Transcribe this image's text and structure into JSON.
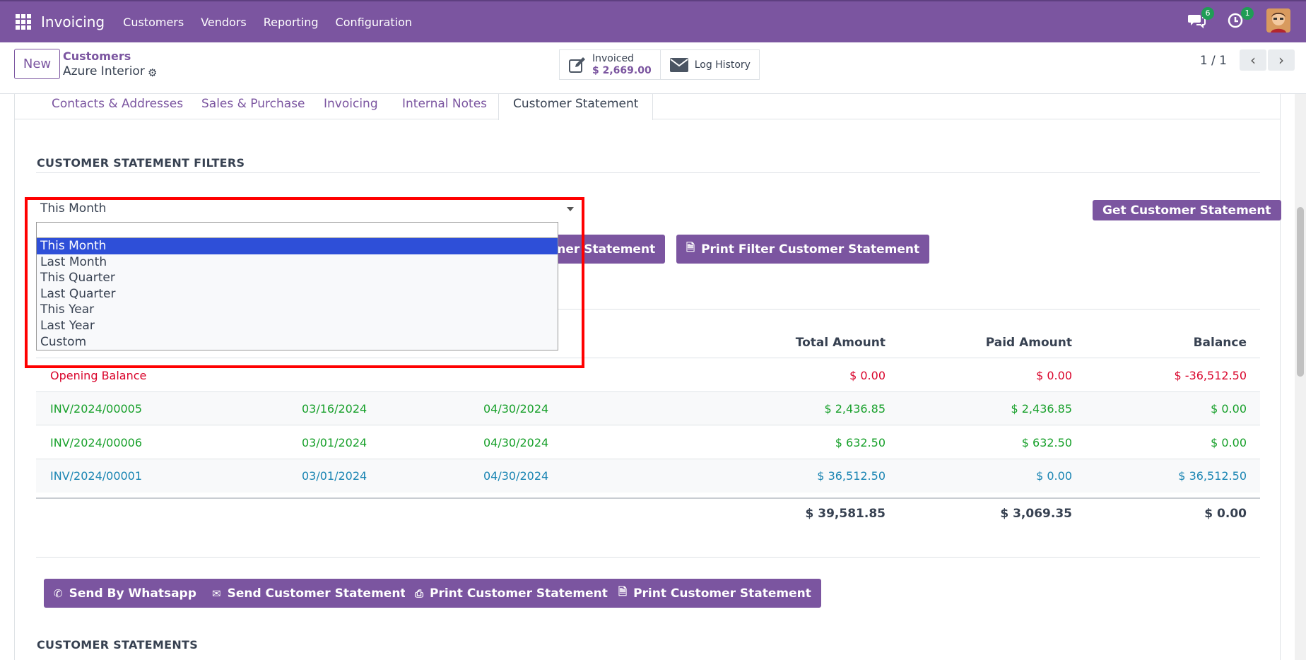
{
  "navbar": {
    "app_title": "Invoicing",
    "menu": [
      "Customers",
      "Vendors",
      "Reporting",
      "Configuration"
    ],
    "chat_badge": "6",
    "activity_badge": "1",
    "color": "#7b55a0"
  },
  "control": {
    "new_label": "New",
    "breadcrumb_parent": "Customers",
    "breadcrumb_current": "Azure Interior",
    "invoiced_label": "Invoiced",
    "invoiced_value": "$ 2,669.00",
    "log_history_label": "Log History",
    "pager": "1 / 1"
  },
  "tabs": [
    "Contacts & Addresses",
    "Sales & Purchase",
    "Invoicing",
    "Internal Notes",
    "Customer Statement"
  ],
  "filters": {
    "section_title": "CUSTOMER STATEMENT FILTERS",
    "selected": "This Month",
    "options": [
      "This Month",
      "Last Month",
      "This Quarter",
      "Last Quarter",
      "This Year",
      "Last Year",
      "Custom"
    ],
    "get_button": "Get Customer Statement",
    "partial_button": "omer Statement",
    "print_filter_button": "Print Filter Customer Statement"
  },
  "table": {
    "headers": {
      "total": "Total Amount",
      "paid": "Paid Amount",
      "balance": "Balance"
    },
    "rows": [
      {
        "ref": "Opening Balance",
        "date": "",
        "due": "",
        "total": "$ 0.00",
        "paid": "$ 0.00",
        "balance": "$ -36,512.50",
        "color": "red"
      },
      {
        "ref": "INV/2024/00005",
        "date": "03/16/2024",
        "due": "04/30/2024",
        "total": "$ 2,436.85",
        "paid": "$ 2,436.85",
        "balance": "$ 0.00",
        "color": "green"
      },
      {
        "ref": "INV/2024/00006",
        "date": "03/01/2024",
        "due": "04/30/2024",
        "total": "$ 632.50",
        "paid": "$ 632.50",
        "balance": "$ 0.00",
        "color": "green"
      },
      {
        "ref": "INV/2024/00001",
        "date": "03/01/2024",
        "due": "04/30/2024",
        "total": "$ 36,512.50",
        "paid": "$ 0.00",
        "balance": "$ 36,512.50",
        "color": "blue"
      }
    ],
    "totals": {
      "total": "$ 39,581.85",
      "paid": "$ 3,069.35",
      "balance": "$ 0.00"
    }
  },
  "actions": {
    "whatsapp": "Send By Whatsapp",
    "send": "Send Customer Statement",
    "print1": "Print Customer Statement",
    "print2": "Print Customer Statement"
  },
  "statements_title": "CUSTOMER STATEMENTS"
}
